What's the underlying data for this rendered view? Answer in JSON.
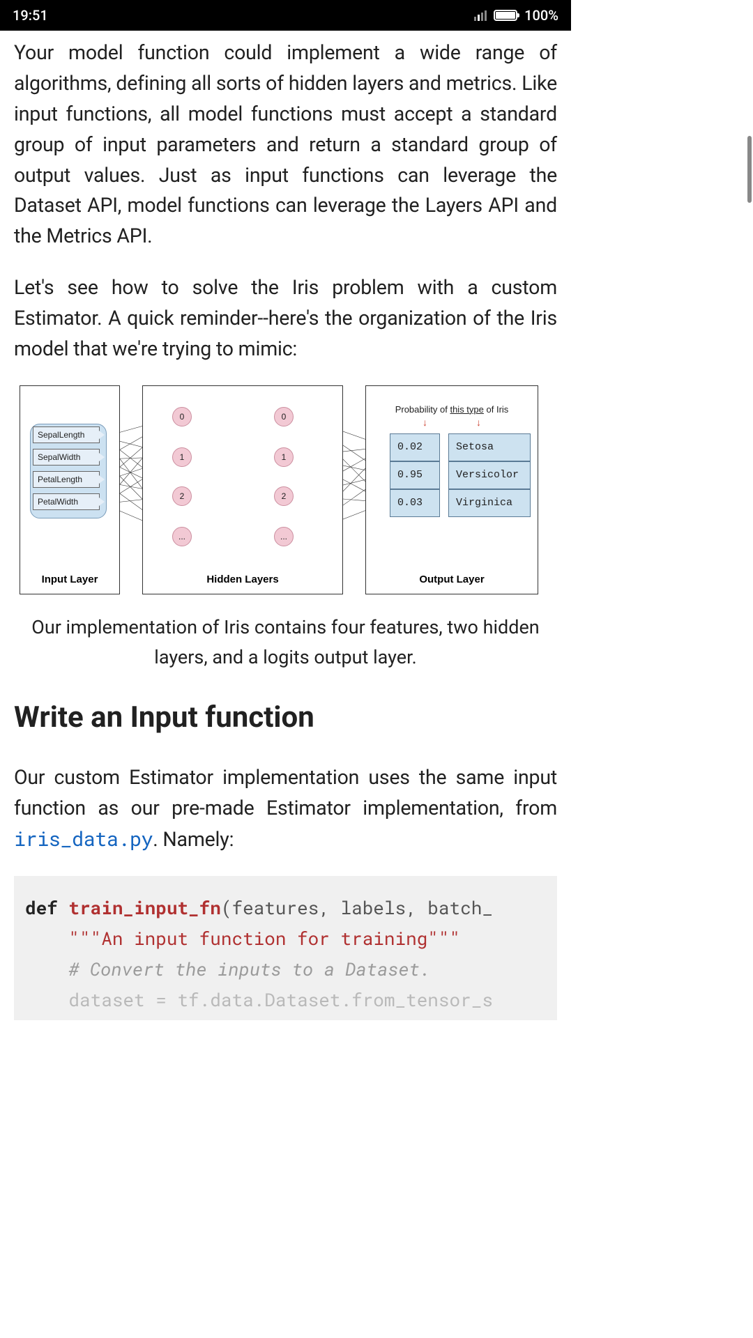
{
  "status": {
    "time": "19:51",
    "battery_pct": "100%"
  },
  "paragraphs": {
    "p1": "Your model function could implement a wide range of algorithms, defining all sorts of hidden layers and metrics. Like input functions, all model functions must accept a standard group of input parameters and return a standard group of output values. Just as input functions can leverage the Dataset API, model functions can leverage the Layers API and the Metrics API.",
    "p2": "Let's see how to solve the Iris problem with a custom Estimator. A quick reminder--here's the organization of the Iris model that we're trying to mimic:",
    "caption": "Our implementation of Iris contains four features, two hidden layers, and a logits output layer.",
    "h2": "Write an Input function",
    "p3a": "Our custom Estimator implementation uses the same input function as our pre-made Estimator implementation, from ",
    "p3link": "iris_data.py",
    "p3b": ". Namely:"
  },
  "diagram": {
    "input_title": "Input Layer",
    "hidden_title": "Hidden Layers",
    "output_title": "Output Layer",
    "features": [
      "SepalLength",
      "SepalWidth",
      "PetalLength",
      "PetalWidth"
    ],
    "hidden_nodes_col1": [
      "0",
      "1",
      "2",
      "..."
    ],
    "hidden_nodes_col2": [
      "0",
      "1",
      "2",
      "..."
    ],
    "output_header_pre": "Probability of ",
    "output_header_underline": "this type",
    "output_header_post": " of Iris",
    "outputs": [
      {
        "prob": "0.02",
        "name": "Setosa"
      },
      {
        "prob": "0.95",
        "name": "Versicolor"
      },
      {
        "prob": "0.03",
        "name": "Virginica"
      }
    ]
  },
  "code": {
    "l1_kw": "def ",
    "l1_fn": "train_input_fn",
    "l1_rest": "(features, labels, batch_",
    "l2": "\"\"\"An input function for training\"\"\"",
    "l3": "# Convert the inputs to a Dataset.",
    "l4": "dataset = tf.data.Dataset.from_tensor_s"
  }
}
